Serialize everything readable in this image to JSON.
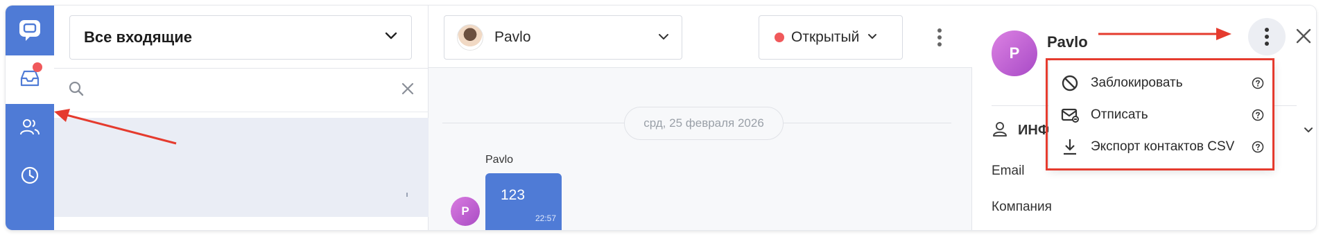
{
  "rail": {
    "items": [
      {
        "name": "chat-logo-icon"
      },
      {
        "name": "inbox-icon",
        "active": true,
        "has_notification": true
      },
      {
        "name": "contacts-icon"
      },
      {
        "name": "history-icon"
      }
    ]
  },
  "inbox": {
    "selected": "Все входящие",
    "search_placeholder": ""
  },
  "conversation": {
    "assignee": "Pavlo",
    "status": "Открытый",
    "status_color": "#f0595b",
    "date_divider": "срд, 25 февраля 2026",
    "messages": [
      {
        "sender": "Pavlo",
        "avatar_letter": "P",
        "text": "123",
        "time": "22:57"
      }
    ]
  },
  "contact": {
    "avatar_letter": "P",
    "name": "Pavlo",
    "section_label_visible": "ИНФ",
    "fields": [
      "Email",
      "Компания"
    ]
  },
  "menu": {
    "items": [
      {
        "label": "Заблокировать",
        "icon": "block-icon"
      },
      {
        "label": "Отписать",
        "icon": "mail-unsubscribe-icon"
      },
      {
        "label": "Экспорт контактов CSV",
        "icon": "download-icon"
      }
    ]
  },
  "colors": {
    "accent": "#4f7bd6",
    "annotation": "#e53b2e",
    "avatar": "#b855cf"
  }
}
